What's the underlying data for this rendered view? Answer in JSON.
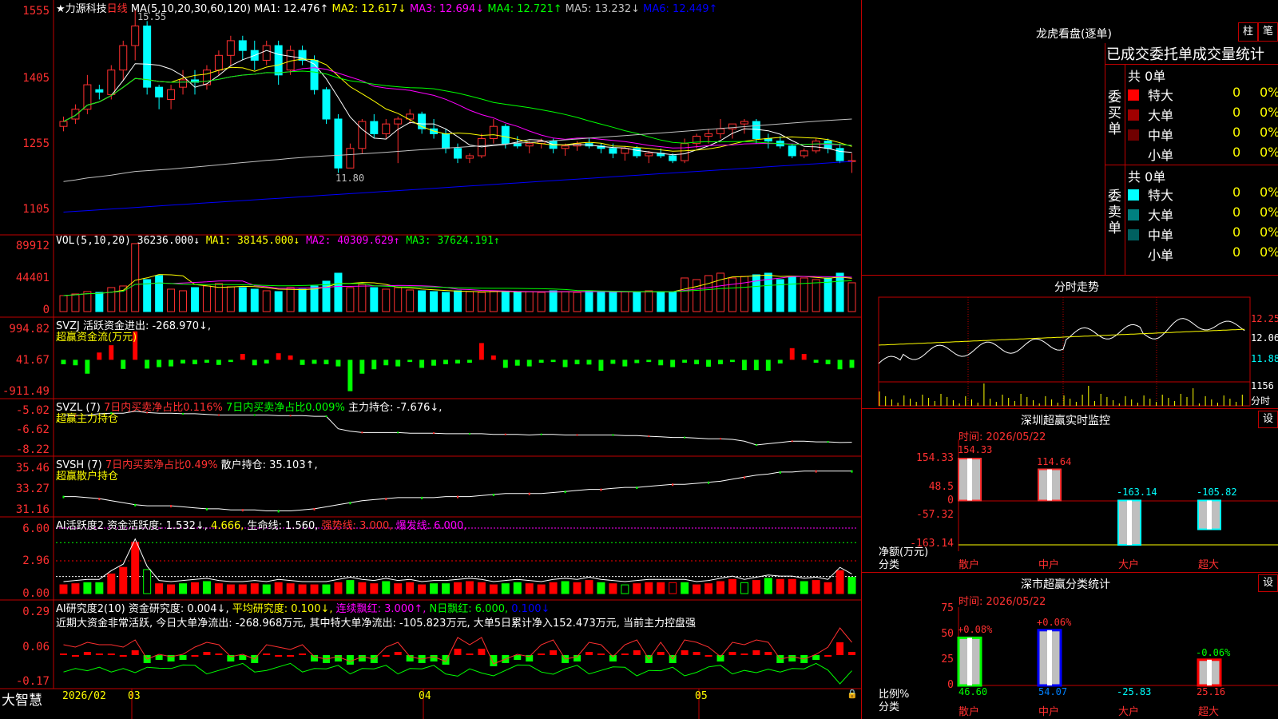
{
  "stock": {
    "star_name": "★力源科技",
    "period": "日线",
    "high_note": "15.55",
    "low_note": "11.80"
  },
  "ma_line": {
    "label": "MA(5,10,20,30,60,120)",
    "items": [
      {
        "text": "MA1: 12.476↑",
        "color": "#ffffff"
      },
      {
        "text": "MA2: 12.617↓",
        "color": "#ffff00"
      },
      {
        "text": "MA3: 12.694↓",
        "color": "#ff00ff"
      },
      {
        "text": "MA4: 12.721↑",
        "color": "#00ff00"
      },
      {
        "text": "MA5: 13.232↓",
        "color": "#c0c0c0"
      },
      {
        "text": "MA6: 12.449↑",
        "color": "#0000ff"
      }
    ]
  },
  "price_axis": [
    "1555",
    "1405",
    "1255",
    "1105"
  ],
  "vol": {
    "label": "VOL(5,10,20)",
    "value": "36236.000↓",
    "items": [
      {
        "text": "MA1: 38145.000↓",
        "color": "#ffff00"
      },
      {
        "text": "MA2: 40309.629↑",
        "color": "#ff00ff"
      },
      {
        "text": "MA3: 37624.191↑",
        "color": "#00ff00"
      }
    ],
    "axis": [
      "89912",
      "44401",
      "0"
    ]
  },
  "svzj": {
    "label": "SVZJ",
    "text": "活跃资金进出: -268.970↓,",
    "sub": "超赢资金流(万元)",
    "axis": [
      "994.82",
      "41.67",
      "-911.49"
    ]
  },
  "svzl": {
    "label": "SVZL (7)",
    "t1": "7日内买卖净占比0.116%",
    "t2": "7日内买卖净占比0.009%",
    "t3": "主力持仓: -7.676↓,",
    "sub": "超赢主力持仓",
    "axis": [
      "-5.02",
      "-6.62",
      "-8.22"
    ]
  },
  "svsh": {
    "label": "SVSH (7)",
    "t1": "7日内买卖净占比0.49%",
    "t2": "散户持仓: 35.103↑,",
    "sub": "超赢散户持仓",
    "axis": [
      "35.46",
      "33.27",
      "31.16"
    ]
  },
  "ai1": {
    "label": "AI活跃度2",
    "t1": "资金活跃度: 1.532↓,",
    "t2": "4.666,",
    "t3": "生命线: 1.560,",
    "t4": "强势线: 3.000,",
    "t5": "爆发线: 6.000,",
    "axis": [
      "6.00",
      "2.96",
      "0.00"
    ]
  },
  "ai2": {
    "label": "AI研究度2(10)",
    "t1": "资金研究度: 0.004↓,",
    "t2": "平均研究度: 0.100↓,",
    "t3": "连续飘红: 3.000↑,",
    "t4": "N日飘红: 6.000,",
    "t5": "0.100↓",
    "comment": "近期大资金非常活跃, 今日大单净流出: -268.968万元, 其中特大单净流出: -105.823万元, 大单5日累计净入152.473万元, 当前主力控盘强",
    "axis": [
      "0.29",
      "0.06",
      "-0.17"
    ]
  },
  "bottom_bar": {
    "brand": "大智慧",
    "dates": [
      "2026/02",
      "03",
      "04",
      "05"
    ]
  },
  "right": {
    "dragon_title": "龙虎看盘(逐单)",
    "btn_bar": "柱",
    "btn_pen": "笔",
    "stats_title": "已成交委托单成交量统计",
    "buy": {
      "side": "委买单",
      "total": "共 0单",
      "rows": [
        {
          "name": "特大",
          "count": "0",
          "pct": "0%",
          "color": "#ff0000"
        },
        {
          "name": "大单",
          "count": "0",
          "pct": "0%",
          "color": "#a00000"
        },
        {
          "name": "中单",
          "count": "0",
          "pct": "0%",
          "color": "#700000"
        },
        {
          "name": "小单",
          "count": "0",
          "pct": "0%",
          "color": "#000000"
        }
      ]
    },
    "sell": {
      "side": "委卖单",
      "total": "共 0单",
      "rows": [
        {
          "name": "特大",
          "count": "0",
          "pct": "0%",
          "color": "#00ffff"
        },
        {
          "name": "大单",
          "count": "0",
          "pct": "0%",
          "color": "#008080"
        },
        {
          "name": "中单",
          "count": "0",
          "pct": "0%",
          "color": "#006060"
        },
        {
          "name": "小单",
          "count": "0",
          "pct": "0%",
          "color": "#000000"
        }
      ]
    },
    "intraday": {
      "title": "分时走势",
      "p1": "12.25",
      "p2": "12.06",
      "p3": "11.88",
      "vol": "1156",
      "vol_unit": "分时"
    },
    "monitor": {
      "title": "深圳超赢实时监控",
      "setting": "设",
      "time": "时间: 2026/05/22",
      "axis": [
        "154.33",
        "48.5",
        "0",
        "-57.32",
        "-163.14"
      ],
      "ylabel": "净额(万元)",
      "xlabel": "分类",
      "bars": [
        {
          "cat": "散户",
          "value": "154.33"
        },
        {
          "cat": "中户",
          "value": "114.64"
        },
        {
          "cat": "大户",
          "value": "-163.14"
        },
        {
          "cat": "超大",
          "value": "-105.82"
        }
      ]
    },
    "classify": {
      "title": "深市超赢分类统计",
      "setting": "设",
      "time": "时间: 2026/05/22",
      "axis": [
        "75",
        "50",
        "25",
        "0"
      ],
      "ylabel": "比例%",
      "xlabel": "分类",
      "bars": [
        {
          "cat": "散户",
          "top": "+0.08%",
          "bottom": "46.60"
        },
        {
          "cat": "中户",
          "top": "+0.06%",
          "bottom": "54.07"
        },
        {
          "cat": "大户",
          "top": "",
          "bottom": "-25.83"
        },
        {
          "cat": "超大",
          "top": "-0.06%",
          "bottom": "25.16"
        }
      ]
    }
  },
  "chart_data": [
    {
      "type": "candlestick",
      "title": "力源科技 日线",
      "ylim": [
        11.0,
        15.6
      ],
      "ohlc": [
        [
          13.15,
          13.35,
          13.05,
          13.25
        ],
        [
          13.3,
          13.6,
          13.2,
          13.5
        ],
        [
          13.5,
          14.2,
          13.4,
          14.0
        ],
        [
          13.9,
          14.0,
          13.7,
          13.85
        ],
        [
          13.8,
          14.4,
          13.7,
          14.3
        ],
        [
          14.3,
          14.9,
          14.1,
          14.8
        ],
        [
          14.8,
          15.55,
          14.5,
          15.2
        ],
        [
          15.2,
          15.3,
          13.8,
          13.95
        ],
        [
          13.95,
          14.0,
          13.5,
          13.75
        ],
        [
          13.7,
          14.0,
          13.5,
          13.9
        ],
        [
          13.95,
          14.3,
          13.8,
          14.1
        ],
        [
          14.1,
          14.3,
          13.8,
          14.05
        ],
        [
          14.0,
          14.4,
          13.9,
          14.3
        ],
        [
          14.3,
          14.7,
          14.2,
          14.6
        ],
        [
          14.6,
          15.0,
          14.4,
          14.9
        ],
        [
          14.9,
          15.0,
          14.5,
          14.7
        ],
        [
          14.7,
          14.9,
          14.3,
          14.5
        ],
        [
          14.5,
          14.9,
          14.4,
          14.8
        ],
        [
          14.8,
          14.9,
          14.0,
          14.2
        ],
        [
          14.3,
          14.8,
          14.2,
          14.7
        ],
        [
          14.7,
          14.8,
          14.4,
          14.5
        ],
        [
          14.5,
          14.6,
          13.8,
          13.9
        ],
        [
          13.9,
          13.95,
          13.2,
          13.3
        ],
        [
          13.3,
          13.4,
          12.2,
          12.3
        ],
        [
          12.3,
          12.8,
          12.3,
          12.7
        ],
        [
          12.7,
          13.3,
          12.6,
          13.25
        ],
        [
          13.25,
          13.4,
          12.9,
          13.0
        ],
        [
          13.0,
          13.3,
          12.9,
          13.2
        ],
        [
          13.2,
          13.35,
          12.4,
          13.3
        ],
        [
          13.3,
          13.5,
          13.2,
          13.4
        ],
        [
          13.4,
          13.45,
          13.0,
          13.1
        ],
        [
          13.1,
          13.3,
          12.9,
          13.0
        ],
        [
          13.0,
          13.1,
          12.6,
          12.7
        ],
        [
          12.7,
          12.8,
          12.4,
          12.5
        ],
        [
          12.5,
          12.6,
          12.4,
          12.55
        ],
        [
          12.55,
          13.0,
          12.5,
          12.9
        ],
        [
          12.9,
          13.3,
          12.8,
          13.15
        ],
        [
          13.15,
          13.2,
          12.7,
          12.8
        ],
        [
          12.8,
          12.95,
          12.7,
          12.75
        ],
        [
          12.75,
          12.85,
          12.6,
          12.8
        ],
        [
          12.8,
          12.9,
          12.7,
          12.85
        ],
        [
          12.85,
          12.9,
          12.6,
          12.7
        ],
        [
          12.7,
          12.8,
          12.55,
          12.75
        ],
        [
          12.75,
          12.85,
          12.65,
          12.8
        ],
        [
          12.8,
          12.9,
          12.7,
          12.75
        ],
        [
          12.75,
          12.8,
          12.6,
          12.7
        ],
        [
          12.7,
          12.8,
          12.5,
          12.6
        ],
        [
          12.6,
          12.75,
          12.45,
          12.7
        ],
        [
          12.7,
          12.75,
          12.5,
          12.55
        ],
        [
          12.55,
          12.65,
          12.4,
          12.6
        ],
        [
          12.6,
          12.7,
          12.5,
          12.55
        ],
        [
          12.55,
          12.6,
          12.4,
          12.45
        ],
        [
          12.45,
          12.9,
          12.4,
          12.8
        ],
        [
          12.8,
          13.0,
          12.7,
          12.95
        ],
        [
          12.95,
          13.1,
          12.8,
          13.0
        ],
        [
          13.0,
          13.3,
          12.9,
          13.1
        ],
        [
          13.1,
          13.2,
          12.9,
          13.2
        ],
        [
          13.2,
          13.3,
          13.0,
          13.25
        ],
        [
          13.25,
          13.3,
          12.8,
          12.9
        ],
        [
          12.9,
          13.0,
          12.7,
          12.85
        ],
        [
          12.85,
          12.95,
          12.7,
          12.75
        ],
        [
          12.75,
          12.8,
          12.5,
          12.55
        ],
        [
          12.55,
          12.7,
          12.5,
          12.65
        ],
        [
          12.65,
          12.9,
          12.6,
          12.85
        ],
        [
          12.85,
          12.9,
          12.6,
          12.7
        ],
        [
          12.7,
          12.8,
          12.4,
          12.45
        ],
        [
          12.45,
          12.6,
          12.2,
          12.45
        ]
      ]
    },
    {
      "type": "bar",
      "title": "VOL(5,10,20)",
      "ylim": [
        0,
        89912
      ],
      "values": [
        20000,
        22000,
        25000,
        24000,
        30000,
        32000,
        85000,
        40000,
        45000,
        28000,
        26000,
        30000,
        32000,
        35000,
        31000,
        30000,
        28000,
        26000,
        25000,
        30000,
        28000,
        32000,
        38000,
        48000,
        30000,
        34000,
        30000,
        28000,
        30000,
        27000,
        26000,
        25000,
        24000,
        26000,
        25000,
        24000,
        26000,
        25000,
        24000,
        25000,
        24000,
        26000,
        25000,
        24000,
        26000,
        25000,
        24000,
        25000,
        24000,
        26000,
        25000,
        24000,
        42000,
        40000,
        45000,
        48000,
        42000,
        44000,
        46000,
        48000,
        40000,
        44000,
        42000,
        40000,
        42000,
        48000,
        36000
      ]
    },
    {
      "type": "bar",
      "title": "SVZJ",
      "ylim": [
        -911.49,
        994.82
      ],
      "values": [
        -120,
        -150,
        -380,
        200,
        400,
        -250,
        780,
        -240,
        -200,
        -180,
        -100,
        -120,
        -80,
        -140,
        -60,
        160,
        -150,
        -100,
        180,
        120,
        -140,
        -110,
        -120,
        -180,
        -860,
        -380,
        -260,
        -150,
        -180,
        -60,
        -220,
        -160,
        -120,
        -100,
        -80,
        460,
        120,
        -220,
        -160,
        -180,
        -80,
        -60,
        -200,
        -120,
        -130,
        -300,
        -110,
        -180,
        -90,
        -60,
        -150,
        -200,
        -80,
        -120,
        -190,
        -120,
        -60,
        -280,
        -280,
        -300,
        -100,
        320,
        160,
        -80,
        -120,
        -260,
        -220
      ]
    },
    {
      "type": "line",
      "title": "SVZL",
      "ylim": [
        -8.22,
        -5.02
      ],
      "values": [
        -5.5,
        -5.55,
        -5.5,
        -5.4,
        -5.35,
        -5.35,
        -5.2,
        -5.3,
        -5.35,
        -5.35,
        -5.4,
        -5.4,
        -5.45,
        -5.5,
        -5.5,
        -5.5,
        -5.5,
        -5.5,
        -5.55,
        -5.55,
        -5.55,
        -5.6,
        -5.6,
        -6.6,
        -6.8,
        -6.9,
        -6.9,
        -6.9,
        -6.9,
        -6.95,
        -6.95,
        -6.95,
        -7.0,
        -7.0,
        -7.0,
        -7.0,
        -7.05,
        -7.05,
        -7.05,
        -7.1,
        -7.05,
        -7.05,
        -7.1,
        -7.1,
        -7.1,
        -7.1,
        -7.1,
        -7.15,
        -7.15,
        -7.2,
        -7.25,
        -7.3,
        -7.3,
        -7.35,
        -7.4,
        -7.4,
        -7.45,
        -7.6,
        -7.9,
        -7.8,
        -7.7,
        -7.6,
        -7.6,
        -7.65,
        -7.65,
        -7.7,
        -7.68
      ]
    },
    {
      "type": "line",
      "title": "SVSH",
      "ylim": [
        31.16,
        35.46
      ],
      "values": [
        32.6,
        32.6,
        32.5,
        32.4,
        32.2,
        32.0,
        31.8,
        31.7,
        31.7,
        31.7,
        31.6,
        31.5,
        31.4,
        31.4,
        31.3,
        31.3,
        31.3,
        31.2,
        31.2,
        31.2,
        31.3,
        31.4,
        31.6,
        31.8,
        32.0,
        32.2,
        32.3,
        32.4,
        32.5,
        32.5,
        32.5,
        32.5,
        32.6,
        32.6,
        32.6,
        32.7,
        32.8,
        32.9,
        32.9,
        32.9,
        32.9,
        33.0,
        33.1,
        33.2,
        33.3,
        33.3,
        33.4,
        33.5,
        33.5,
        33.6,
        33.7,
        33.8,
        33.8,
        33.9,
        34.0,
        34.1,
        34.3,
        34.5,
        34.7,
        34.8,
        35.0,
        35.0,
        35.1,
        35.1,
        35.1,
        35.1,
        35.1
      ]
    },
    {
      "type": "bar",
      "title": "AI活跃度2",
      "ylim": [
        0,
        6.0
      ],
      "values": [
        0.8,
        0.9,
        1.0,
        1.0,
        1.8,
        2.4,
        4.7,
        2.2,
        0.9,
        0.8,
        0.9,
        1.0,
        1.1,
        0.9,
        0.8,
        0.8,
        0.9,
        0.8,
        1.0,
        0.9,
        0.8,
        0.8,
        0.8,
        1.0,
        1.2,
        1.0,
        0.9,
        1.1,
        0.9,
        1.0,
        0.8,
        0.9,
        0.9,
        1.0,
        1.1,
        1.0,
        0.8,
        0.9,
        1.0,
        0.9,
        0.8,
        1.0,
        1.1,
        1.0,
        1.2,
        1.0,
        0.9,
        0.8,
        0.9,
        1.0,
        1.0,
        1.0,
        1.0,
        0.8,
        0.9,
        1.1,
        1.3,
        1.0,
        1.2,
        1.4,
        1.3,
        1.3,
        1.1,
        1.2,
        1.0,
        2.1,
        1.5
      ]
    },
    {
      "type": "bar",
      "title": "AI研究度2(10)",
      "ylim": [
        -0.17,
        0.29
      ],
      "values": [
        0.03,
        0.02,
        0.04,
        0.03,
        0.03,
        0.02,
        0.05,
        -0.03,
        -0.01,
        -0.02,
        -0.01,
        0.02,
        0.04,
        0.03,
        -0.02,
        -0.01,
        -0.03,
        0.03,
        0.02,
        0.01,
        0.03,
        -0.02,
        -0.03,
        -0.02,
        -0.04,
        -0.02,
        -0.03,
        0.02,
        0.04,
        -0.02,
        -0.03,
        -0.02,
        -0.04,
        0.06,
        0.03,
        0.06,
        -0.05,
        -0.03,
        -0.01,
        -0.02,
        0.03,
        0.05,
        -0.03,
        -0.02,
        0.04,
        0.03,
        -0.02,
        0.03,
        0.05,
        -0.03,
        0.04,
        -0.03,
        0.05,
        0.04,
        0.02,
        -0.02,
        0.04,
        0.03,
        0.05,
        0.04,
        -0.03,
        -0.02,
        -0.03,
        -0.01,
        0.02,
        0.1,
        0.04
      ]
    }
  ]
}
